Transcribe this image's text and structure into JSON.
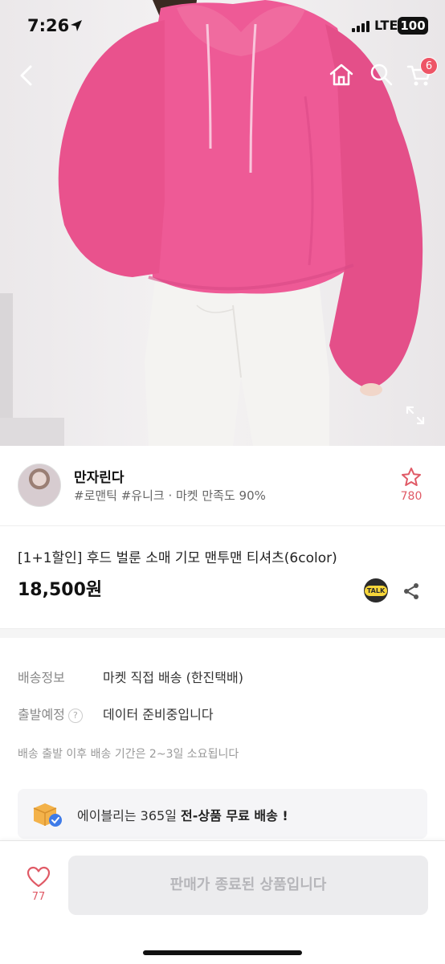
{
  "status_bar": {
    "time": "7:26",
    "network": "LTE",
    "battery": "100"
  },
  "nav": {
    "cart_count": "6"
  },
  "seller": {
    "name": "만자린다",
    "tags": "#로맨틱 #유니크 · 마켓 만족도 90%",
    "favorite_count": "780"
  },
  "product": {
    "title": "[1+1할인] 후드 벌룬 소매 기모 맨투맨 티셔츠(6color)",
    "price": "18,500원",
    "talk_label": "TALK"
  },
  "shipping": {
    "info_label": "배송정보",
    "info_value": "마켓 직접 배송 (한진택배)",
    "departure_label": "출발예정",
    "departure_help": "?",
    "departure_value": "데이터 준비중입니다",
    "note": "배송 출발 이후 배송 기간은 2~3일 소요됩니다",
    "promo_prefix": "에이블리는 365일 ",
    "promo_bold": "전-상품 무료 배송 !"
  },
  "bottom_bar": {
    "like_count": "77",
    "status_button": "판매가 종료된 상품입니다"
  },
  "colors": {
    "hoodie": "#ee5a96",
    "accent": "#e05a66",
    "badge": "#ee5566"
  }
}
